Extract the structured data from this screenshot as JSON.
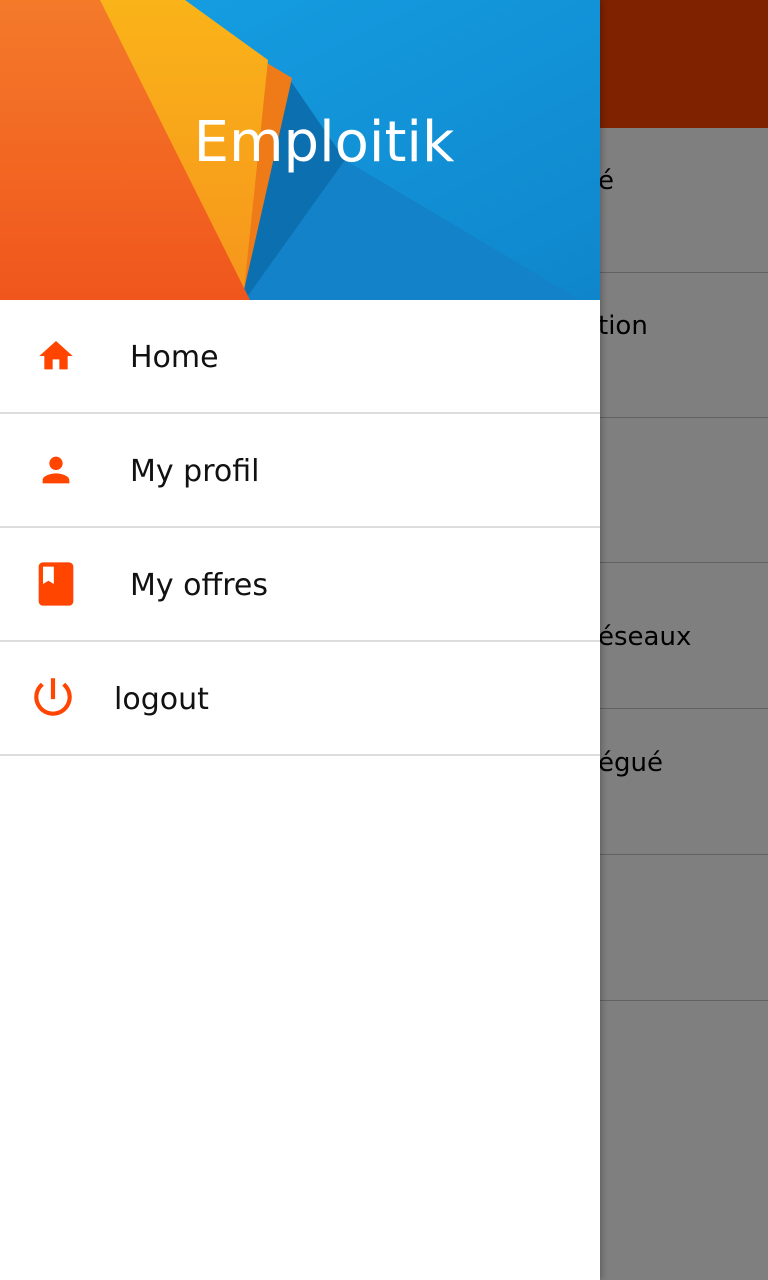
{
  "app": {
    "rows": [
      {
        "text": "é"
      },
      {
        "text": "tion"
      },
      {
        "text": ""
      },
      {
        "text": "éseaux"
      },
      {
        "text": "égué"
      },
      {
        "text": ""
      },
      {
        "text": ""
      }
    ]
  },
  "drawer": {
    "title": "Emploitik",
    "items": [
      {
        "label": "Home",
        "icon": "home-icon"
      },
      {
        "label": "My profil",
        "icon": "person-icon"
      },
      {
        "label": "My offres",
        "icon": "book-icon"
      },
      {
        "label": "logout",
        "icon": "power-icon"
      }
    ]
  },
  "colors": {
    "accent": "#ff4500",
    "toolbar": "#ff4400",
    "header_blue": "#1296dd",
    "header_orange": "#f36c24",
    "header_yellow": "#f9a61a"
  }
}
